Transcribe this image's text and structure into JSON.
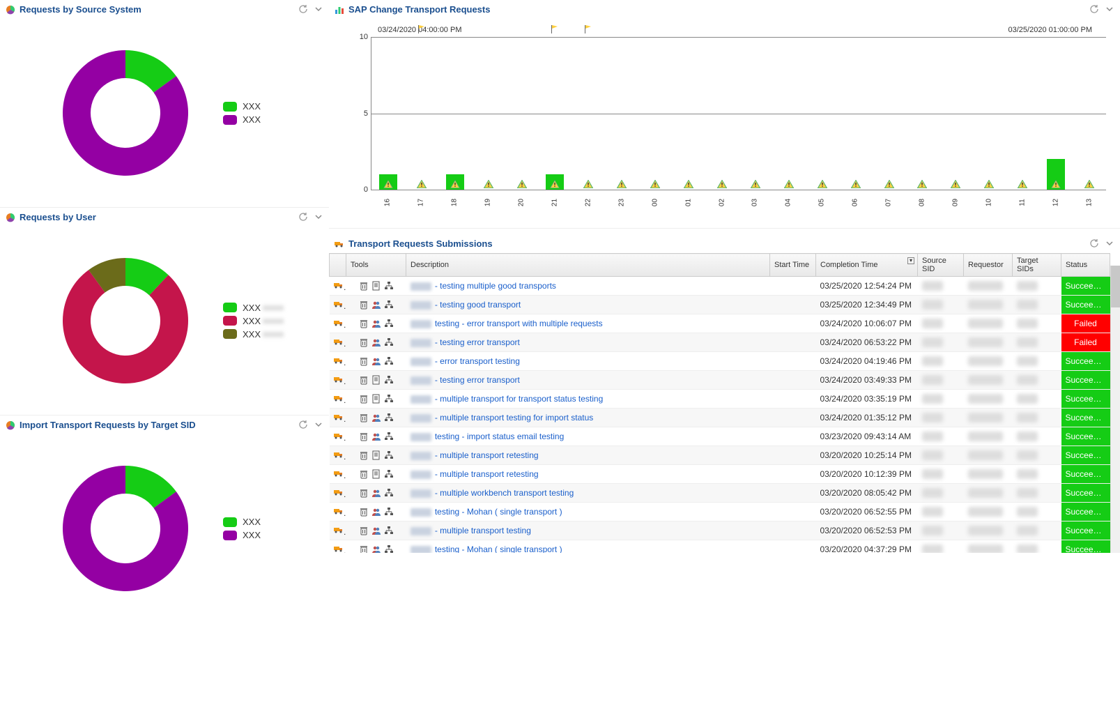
{
  "panels": {
    "source_system": {
      "title": "Requests by Source System"
    },
    "by_user": {
      "title": "Requests by User"
    },
    "target_sid": {
      "title": "Import Transport Requests by Target SID"
    },
    "sap_change": {
      "title": "SAP Change Transport Requests"
    },
    "submissions": {
      "title": "Transport Requests Submissions"
    }
  },
  "chart_data": [
    {
      "id": "source_system",
      "type": "pie",
      "title": "Requests by Source System",
      "series": [
        {
          "name": "XXX",
          "value": 15,
          "color": "#15CC15"
        },
        {
          "name": "XXX",
          "value": 85,
          "color": "#9400A3"
        }
      ]
    },
    {
      "id": "by_user",
      "type": "pie",
      "title": "Requests by User",
      "series": [
        {
          "name": "XXX",
          "value": 12,
          "color": "#15CC15"
        },
        {
          "name": "XXX",
          "value": 78,
          "color": "#C4154B"
        },
        {
          "name": "XXX",
          "value": 10,
          "color": "#6B6B1A"
        }
      ]
    },
    {
      "id": "target_sid",
      "type": "pie",
      "title": "Import Transport Requests by Target SID",
      "series": [
        {
          "name": "XXX",
          "value": 15,
          "color": "#15CC15"
        },
        {
          "name": "XXX",
          "value": 85,
          "color": "#9400A3"
        }
      ]
    },
    {
      "id": "sap_change",
      "type": "bar",
      "title": "SAP Change Transport Requests",
      "time_range_start": "03/24/2020 04:00:00 PM",
      "time_range_end": "03/25/2020 01:00:00 PM",
      "ylim": [
        0,
        10
      ],
      "yticks": [
        0,
        5,
        10
      ],
      "categories": [
        "16",
        "17",
        "18",
        "19",
        "20",
        "21",
        "22",
        "23",
        "00",
        "01",
        "02",
        "03",
        "04",
        "05",
        "06",
        "07",
        "08",
        "09",
        "10",
        "11",
        "12",
        "13"
      ],
      "values": [
        1,
        0,
        1,
        0,
        0,
        1,
        0,
        0,
        0,
        0,
        0,
        0,
        0,
        0,
        0,
        0,
        0,
        0,
        0,
        0,
        2,
        0
      ],
      "flag_markers_at": [
        "17",
        "21",
        "22"
      ]
    }
  ],
  "table": {
    "columns": [
      "",
      "Tools",
      "Description",
      "Start Time",
      "Completion Time",
      "Source SID",
      "Requestor",
      "Target SIDs",
      "Status"
    ],
    "sort_column": "Completion Time",
    "rows": [
      {
        "desc": "- testing multiple good transports",
        "completion": "03/25/2020 12:54:24 PM",
        "status": "Succeeded",
        "tools_variant": "a"
      },
      {
        "desc": "- testing good transport",
        "completion": "03/25/2020 12:34:49 PM",
        "status": "Succeeded",
        "tools_variant": "b"
      },
      {
        "desc": "testing - error transport with multiple requests",
        "completion": "03/24/2020 10:06:07 PM",
        "status": "Failed",
        "tools_variant": "b"
      },
      {
        "desc": "- testing error transport",
        "completion": "03/24/2020 06:53:22 PM",
        "status": "Failed",
        "tools_variant": "b"
      },
      {
        "desc": "- error transport testing",
        "completion": "03/24/2020 04:19:46 PM",
        "status": "Succeeded",
        "tools_variant": "b"
      },
      {
        "desc": "- testing error transport",
        "completion": "03/24/2020 03:49:33 PM",
        "status": "Succeeded",
        "tools_variant": "a"
      },
      {
        "desc": "- multiple transport for transport status testing",
        "completion": "03/24/2020 03:35:19 PM",
        "status": "Succeeded",
        "tools_variant": "a"
      },
      {
        "desc": "- multiple transport testing for import status",
        "completion": "03/24/2020 01:35:12 PM",
        "status": "Succeeded",
        "tools_variant": "b"
      },
      {
        "desc": "testing - import status email testing",
        "completion": "03/23/2020 09:43:14 AM",
        "status": "Succeeded",
        "tools_variant": "b"
      },
      {
        "desc": "- multiple transport retesting",
        "completion": "03/20/2020 10:25:14 PM",
        "status": "Succeeded",
        "tools_variant": "a"
      },
      {
        "desc": "- multiple transport retesting",
        "completion": "03/20/2020 10:12:39 PM",
        "status": "Succeeded",
        "tools_variant": "a"
      },
      {
        "desc": "- multiple workbench transport testing",
        "completion": "03/20/2020 08:05:42 PM",
        "status": "Succeeded",
        "tools_variant": "b"
      },
      {
        "desc": "testing - Mohan ( single transport )",
        "completion": "03/20/2020 06:52:55 PM",
        "status": "Succeeded",
        "tools_variant": "b"
      },
      {
        "desc": "- multiple transport testing",
        "completion": "03/20/2020 06:52:53 PM",
        "status": "Succeeded",
        "tools_variant": "b"
      },
      {
        "desc": "testing - Mohan ( single transport )",
        "completion": "03/20/2020 04:37:29 PM",
        "status": "Succeeded",
        "tools_variant": "b"
      }
    ]
  }
}
